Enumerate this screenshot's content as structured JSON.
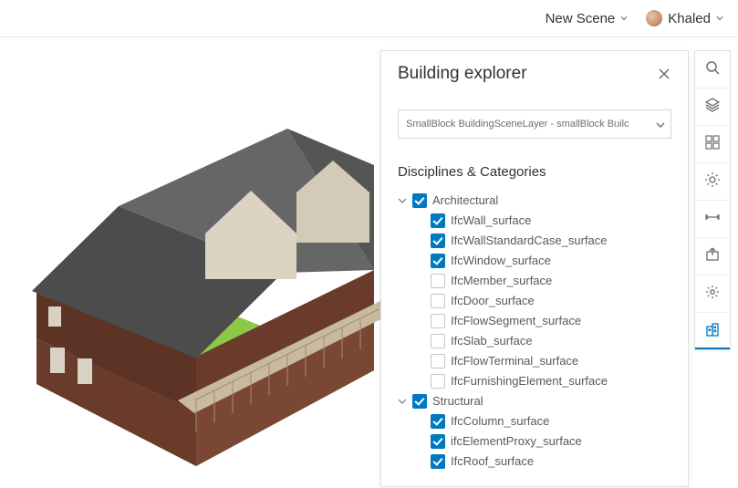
{
  "header": {
    "scene_label": "New Scene",
    "user_name": "Khaled"
  },
  "panel": {
    "title": "Building explorer",
    "layer_select": "SmallBlock BuildingSceneLayer - smallBlock Builc",
    "section_title": "Disciplines & Categories",
    "tree": [
      {
        "label": "Architectural",
        "checked": true,
        "expanded": true,
        "children": [
          {
            "label": "IfcWall_surface",
            "checked": true
          },
          {
            "label": "IfcWallStandardCase_surface",
            "checked": true
          },
          {
            "label": "IfcWindow_surface",
            "checked": true
          },
          {
            "label": "IfcMember_surface",
            "checked": false
          },
          {
            "label": "IfcDoor_surface",
            "checked": false
          },
          {
            "label": "IfcFlowSegment_surface",
            "checked": false
          },
          {
            "label": "IfcSlab_surface",
            "checked": false
          },
          {
            "label": "IfcFlowTerminal_surface",
            "checked": false
          },
          {
            "label": "IfcFurnishingElement_surface",
            "checked": false
          }
        ]
      },
      {
        "label": "Structural",
        "checked": true,
        "expanded": true,
        "children": [
          {
            "label": "IfcColumn_surface",
            "checked": true
          },
          {
            "label": "ifcElementProxy_surface",
            "checked": true
          },
          {
            "label": "IfcRoof_surface",
            "checked": true
          }
        ]
      }
    ]
  },
  "tools": [
    {
      "id": "search",
      "name": "search-icon"
    },
    {
      "id": "layers",
      "name": "layers-icon"
    },
    {
      "id": "basemap",
      "name": "basemap-icon"
    },
    {
      "id": "daylight",
      "name": "daylight-icon"
    },
    {
      "id": "measure",
      "name": "measure-icon"
    },
    {
      "id": "share",
      "name": "share-icon"
    },
    {
      "id": "settings",
      "name": "gear-icon"
    },
    {
      "id": "building",
      "name": "building-icon",
      "active": true
    }
  ]
}
